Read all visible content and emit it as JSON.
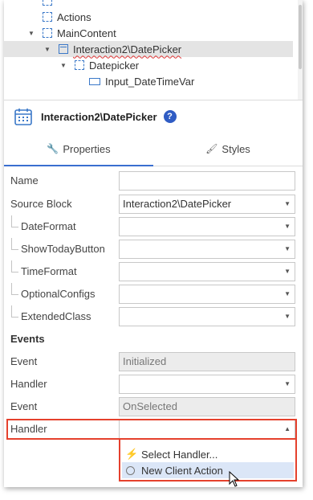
{
  "tree": {
    "items": [
      {
        "label": "Actions",
        "indent": 2,
        "icon": "bracket-icon",
        "caret": ""
      },
      {
        "label": "MainContent",
        "indent": 1,
        "icon": "bracket-icon",
        "caret": "▼"
      },
      {
        "label": "Interaction2\\DatePicker",
        "indent": 2,
        "icon": "calendar-icon",
        "caret": "▼",
        "selected": true
      },
      {
        "label": "Datepicker",
        "indent": 3,
        "icon": "bracket-icon",
        "caret": "▼"
      },
      {
        "label": "Input_DateTimeVar",
        "indent": 4,
        "icon": "input-icon",
        "caret": ""
      }
    ]
  },
  "header": {
    "title": "Interaction2\\DatePicker",
    "help": "?"
  },
  "tabs": {
    "properties": "Properties",
    "styles": "Styles"
  },
  "properties": {
    "name_label": "Name",
    "name_value": "",
    "source_block_label": "Source Block",
    "source_block_value": "Interaction2\\DatePicker",
    "params": [
      {
        "label": "DateFormat",
        "value": ""
      },
      {
        "label": "ShowTodayButton",
        "value": ""
      },
      {
        "label": "TimeFormat",
        "value": ""
      },
      {
        "label": "OptionalConfigs",
        "value": ""
      },
      {
        "label": "ExtendedClass",
        "value": ""
      }
    ]
  },
  "events": {
    "section_label": "Events",
    "event1_label": "Event",
    "event1_value": "Initialized",
    "handler1_label": "Handler",
    "handler1_value": "",
    "event2_label": "Event",
    "event2_value": "OnSelected",
    "handler2_label": "Handler",
    "handler2_value": ""
  },
  "dropdown": {
    "options": [
      {
        "label": "Select Handler...",
        "icon": "lightning-icon"
      },
      {
        "label": "New Client Action",
        "icon": "circle-icon",
        "hovered": true
      }
    ]
  },
  "colors": {
    "accent": "#3a6fd0",
    "highlight": "#e5412d",
    "icon_blue": "#3a78c8",
    "help_badge": "#2f5cc4",
    "bolt": "#e8912a"
  }
}
